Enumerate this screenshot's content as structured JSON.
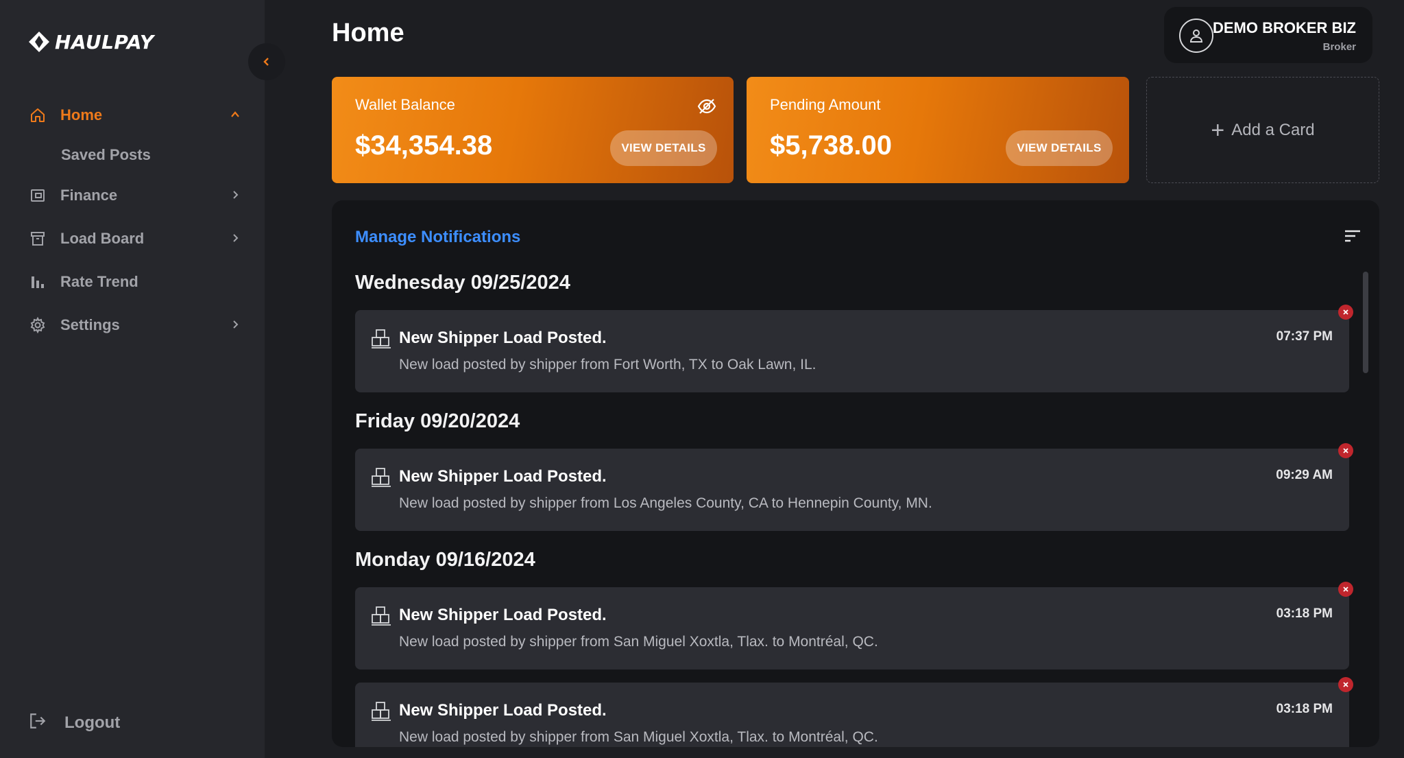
{
  "app": {
    "logo_text": "HAULPAY",
    "page_title": "Home"
  },
  "sidebar": {
    "items": [
      {
        "label": "Home",
        "icon": "home-icon",
        "active": true,
        "expanded": true
      },
      {
        "label": "Finance",
        "icon": "wallet-icon"
      },
      {
        "label": "Load Board",
        "icon": "archive-icon"
      },
      {
        "label": "Rate Trend",
        "icon": "bar-chart-icon"
      },
      {
        "label": "Settings",
        "icon": "gear-icon"
      }
    ],
    "subitems": [
      {
        "label": "Saved Posts"
      }
    ],
    "logout_label": "Logout"
  },
  "user": {
    "name": "DEMO BROKER BIZ",
    "role": "Broker"
  },
  "cards": {
    "wallet": {
      "label": "Wallet Balance",
      "amount": "$34,354.38",
      "button": "VIEW DETAILS"
    },
    "pending": {
      "label": "Pending Amount",
      "amount": "$5,738.00",
      "button": "VIEW DETAILS"
    },
    "add_card_label": "Add a Card"
  },
  "notifications": {
    "heading": "Manage Notifications",
    "groups": [
      {
        "date": "Wednesday 09/25/2024",
        "items": [
          {
            "title": "New Shipper Load Posted.",
            "description": "New load posted by shipper from Fort Worth, TX to Oak Lawn, IL.",
            "time": "07:37 PM"
          }
        ]
      },
      {
        "date": "Friday 09/20/2024",
        "items": [
          {
            "title": "New Shipper Load Posted.",
            "description": "New load posted by shipper from Los Angeles County, CA to Hennepin County, MN.",
            "time": "09:29 AM"
          }
        ]
      },
      {
        "date": "Monday 09/16/2024",
        "items": [
          {
            "title": "New Shipper Load Posted.",
            "description": "New load posted by shipper from San Miguel Xoxtla, Tlax. to Montréal, QC.",
            "time": "03:18 PM"
          },
          {
            "title": "New Shipper Load Posted.",
            "description": "New load posted by shipper from San Miguel Xoxtla, Tlax. to Montréal, QC.",
            "time": "03:18 PM"
          }
        ]
      }
    ]
  },
  "colors": {
    "accent": "#ef7a1a",
    "link": "#3d8eff",
    "close": "#c0262d",
    "sidebar_bg": "#26272c",
    "page_bg": "#1d1e22"
  }
}
